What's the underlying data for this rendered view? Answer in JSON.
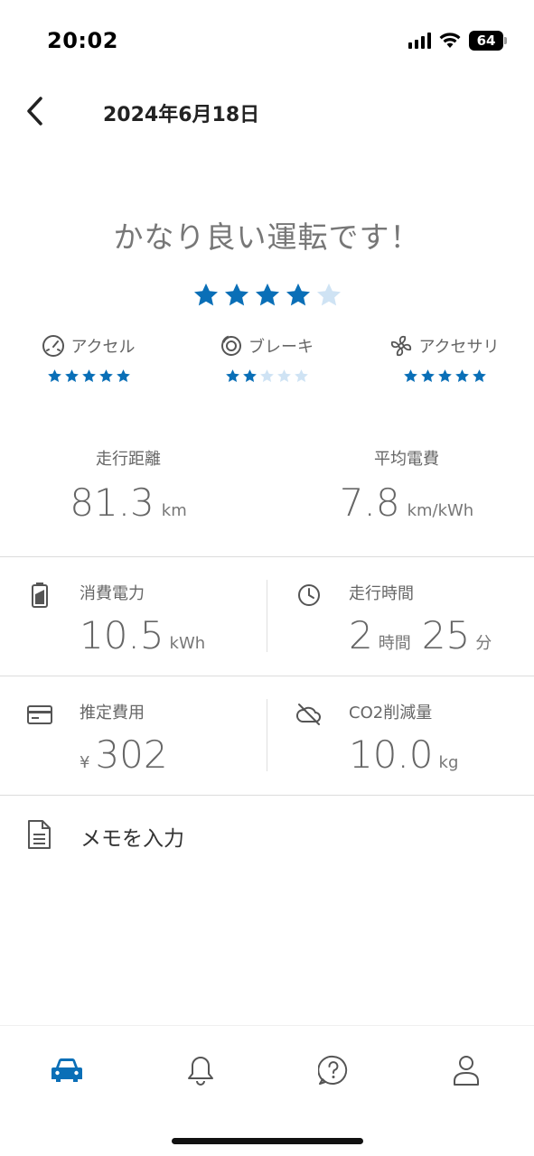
{
  "status_bar": {
    "time": "20:02",
    "battery": "64"
  },
  "header": {
    "title": "2024年6月18日"
  },
  "rating": {
    "title": "かなり良い運転です！",
    "overall_stars": 4,
    "max_stars": 5,
    "categories": [
      {
        "label": "アクセル",
        "stars": 5,
        "icon": "speedometer-icon"
      },
      {
        "label": "ブレーキ",
        "stars": 2,
        "icon": "brake-disc-icon"
      },
      {
        "label": "アクセサリ",
        "stars": 5,
        "icon": "fan-icon"
      }
    ]
  },
  "stats": {
    "distance": {
      "label": "走行距離",
      "value": "81.3",
      "unit": "km"
    },
    "efficiency": {
      "label": "平均電費",
      "value": "7.8",
      "unit": "km/kWh"
    },
    "power": {
      "label": "消費電力",
      "value": "10.5",
      "unit": "kWh",
      "icon": "battery-icon"
    },
    "drive_time": {
      "label": "走行時間",
      "hours": "2",
      "hours_unit": "時間",
      "minutes": "25",
      "minutes_unit": "分",
      "icon": "clock-icon"
    },
    "cost": {
      "label": "推定費用",
      "currency": "¥",
      "value": "302",
      "icon": "credit-card-icon"
    },
    "co2": {
      "label": "CO2削減量",
      "value": "10.0",
      "unit": "kg",
      "icon": "cloud-off-icon"
    }
  },
  "memo": {
    "label": "メモを入力",
    "icon": "document-icon"
  },
  "nav": [
    {
      "name": "car",
      "icon": "car-icon",
      "active": true
    },
    {
      "name": "notifications",
      "icon": "bell-icon",
      "active": false
    },
    {
      "name": "help",
      "icon": "help-icon",
      "active": false
    },
    {
      "name": "profile",
      "icon": "person-icon",
      "active": false
    }
  ],
  "colors": {
    "accent": "#0a6fb7",
    "star_off": "#cfe3f4",
    "text_muted": "#666666"
  }
}
